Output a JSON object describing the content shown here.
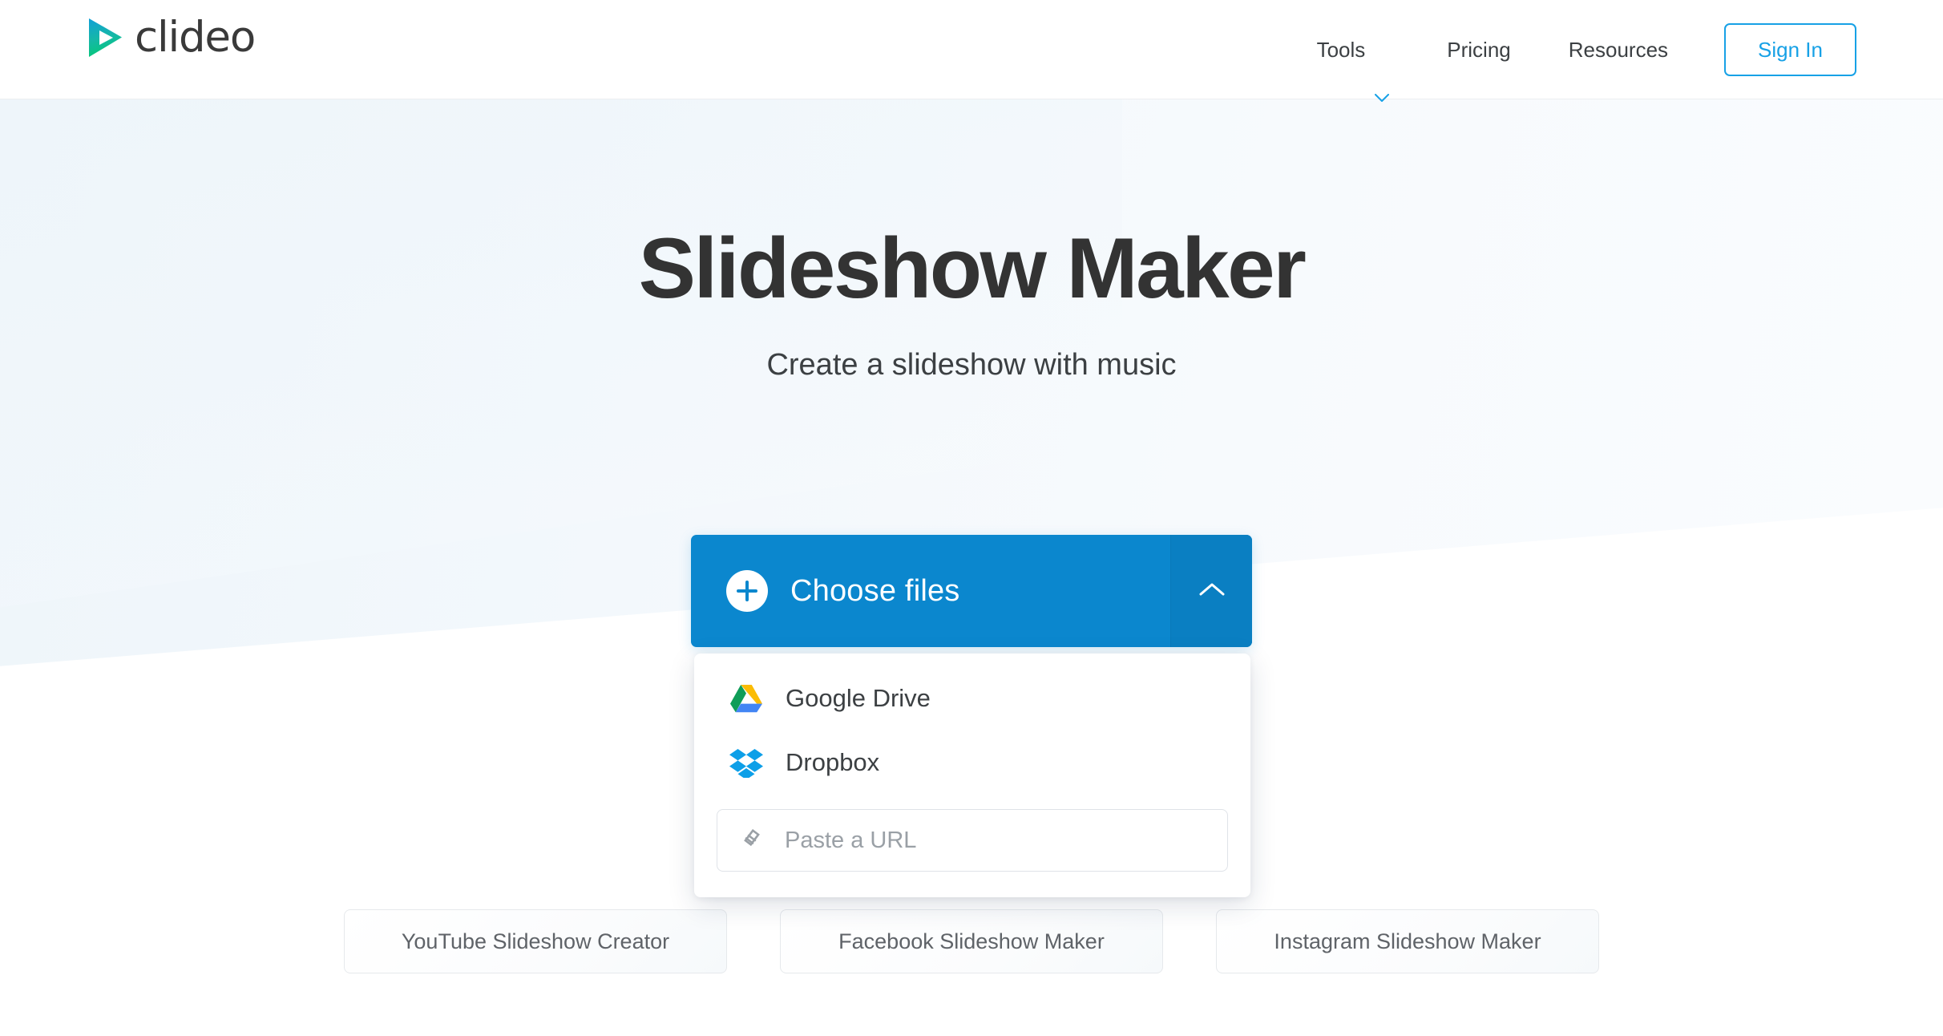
{
  "header": {
    "logo": {
      "name": "clideo",
      "mark_icon": "play-triangle-icon",
      "gradient_start": "#0f9fd8",
      "gradient_end": "#06c77a"
    },
    "nav": [
      {
        "label": "Tools",
        "has_chevron": true,
        "icon": "chevron-down-icon"
      },
      {
        "label": "Pricing",
        "has_chevron": false
      },
      {
        "label": "Resources",
        "has_chevron": false
      }
    ],
    "sign_in_label": "Sign In",
    "accent_color": "#17a1e6"
  },
  "hero": {
    "title": "Slideshow Maker",
    "subtitle": "Create a slideshow with music"
  },
  "uploader": {
    "choose_files_label": "Choose files",
    "plus_icon": "plus-icon",
    "toggle_icon": "chevron-up-icon",
    "button_color": "#0b87ce",
    "toggle_color": "#0a7fc2",
    "dropdown": {
      "items": [
        {
          "label": "Google Drive",
          "icon": "google-drive-icon"
        },
        {
          "label": "Dropbox",
          "icon": "dropbox-icon"
        }
      ],
      "url_field": {
        "placeholder": "Paste a URL",
        "value": "",
        "icon": "link-icon"
      }
    }
  },
  "bottom_links": [
    {
      "label": "YouTube Slideshow Creator"
    },
    {
      "label": "Facebook Slideshow Maker"
    },
    {
      "label": "Instagram Slideshow Maker"
    }
  ]
}
